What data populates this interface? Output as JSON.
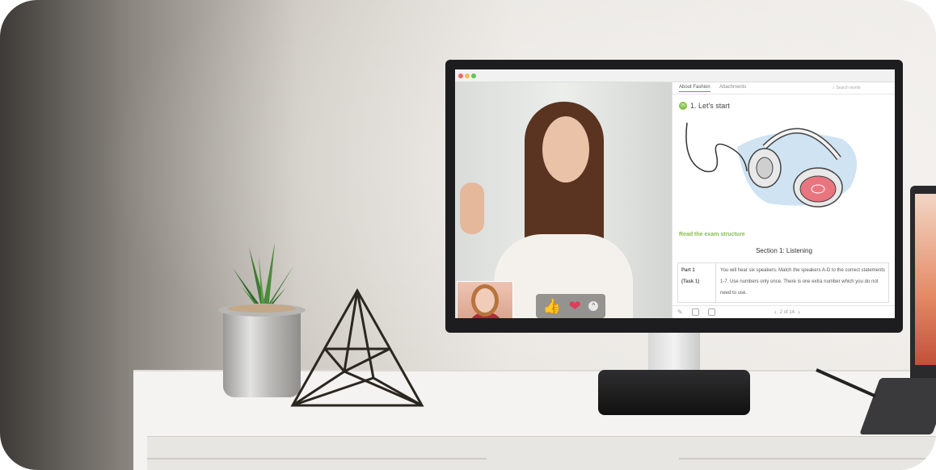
{
  "colors": {
    "accent": "#86c049",
    "tab_underline": "#5b8ad3",
    "traffic": [
      "#ee6a5f",
      "#f5be4f",
      "#62c655"
    ]
  },
  "panel": {
    "tabs": [
      {
        "label": "About Fashion"
      },
      {
        "label": "Attachments"
      }
    ],
    "search_placeholder": "Search words",
    "lesson": {
      "badge": "05",
      "title": "1. Let's start"
    },
    "read_label": "Read the exam structure",
    "section_title": "Section 1: Listening",
    "table": {
      "part": "Part 1",
      "task": "(Task 1)",
      "text": "You will hear six speakers. Match the speakers A-D to the correct statements 1-7. Use numbers only once. There is one extra number which you do not need to use."
    },
    "pager": {
      "prev_icon": "chevron-left-icon",
      "label": "2 of 14",
      "next_icon": "chevron-right-icon"
    }
  },
  "reactions": {
    "thumbs_up": "👍",
    "heart": "❤",
    "more": "^"
  }
}
